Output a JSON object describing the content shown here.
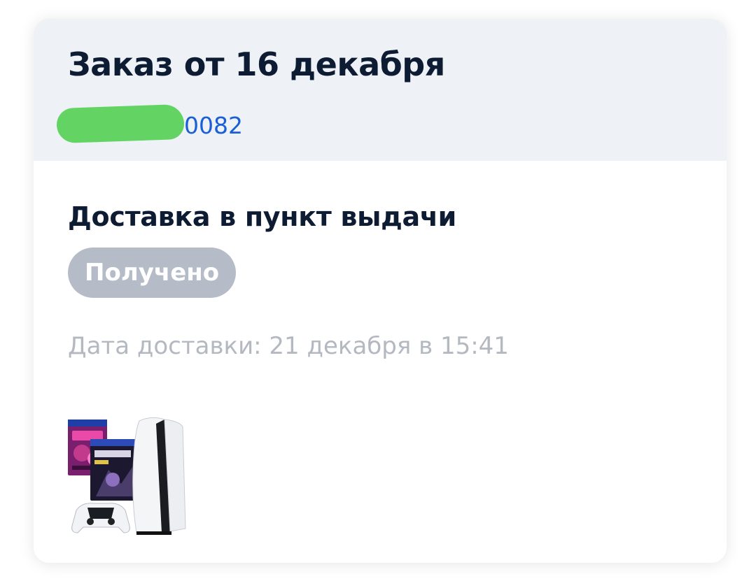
{
  "order": {
    "title": "Заказ от 16 декабря",
    "number_suffix": "0082"
  },
  "delivery": {
    "method": "Доставка в пункт выдачи",
    "status": "Получено",
    "date_text": "Дата доставки: 21 декабря в 15:41"
  },
  "product": {
    "image_icon": "ps5-bundle-image"
  },
  "colors": {
    "header_bg": "#eef1f5",
    "title": "#0d1b33",
    "order_number": "#1a5fd6",
    "badge_bg": "#b6bcc7",
    "muted_text": "#b3b8c1",
    "redaction": "#63d463"
  }
}
